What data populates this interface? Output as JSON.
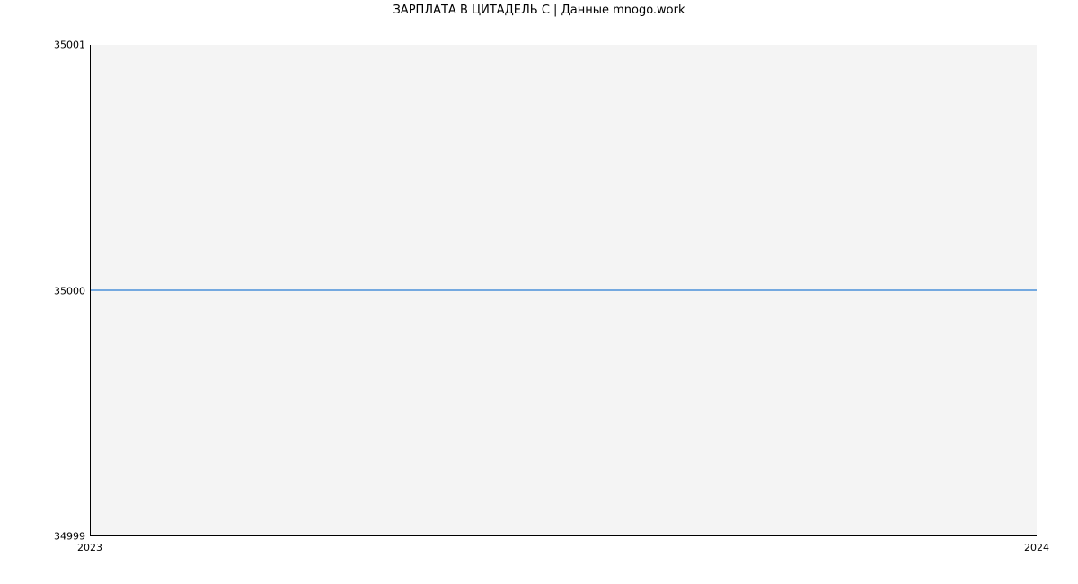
{
  "chart_data": {
    "type": "line",
    "title": "ЗАРПЛАТА В ЦИТАДЕЛЬ С | Данные mnogo.work",
    "x": [
      2023,
      2024
    ],
    "y": [
      35000,
      35000
    ],
    "xlim": [
      2023,
      2024
    ],
    "ylim": [
      34999,
      35001
    ],
    "xticks": [
      2023,
      2024
    ],
    "yticks": [
      34999,
      35000,
      35001
    ],
    "xlabel": "",
    "ylabel": "",
    "line_color": "#4a90d9"
  }
}
